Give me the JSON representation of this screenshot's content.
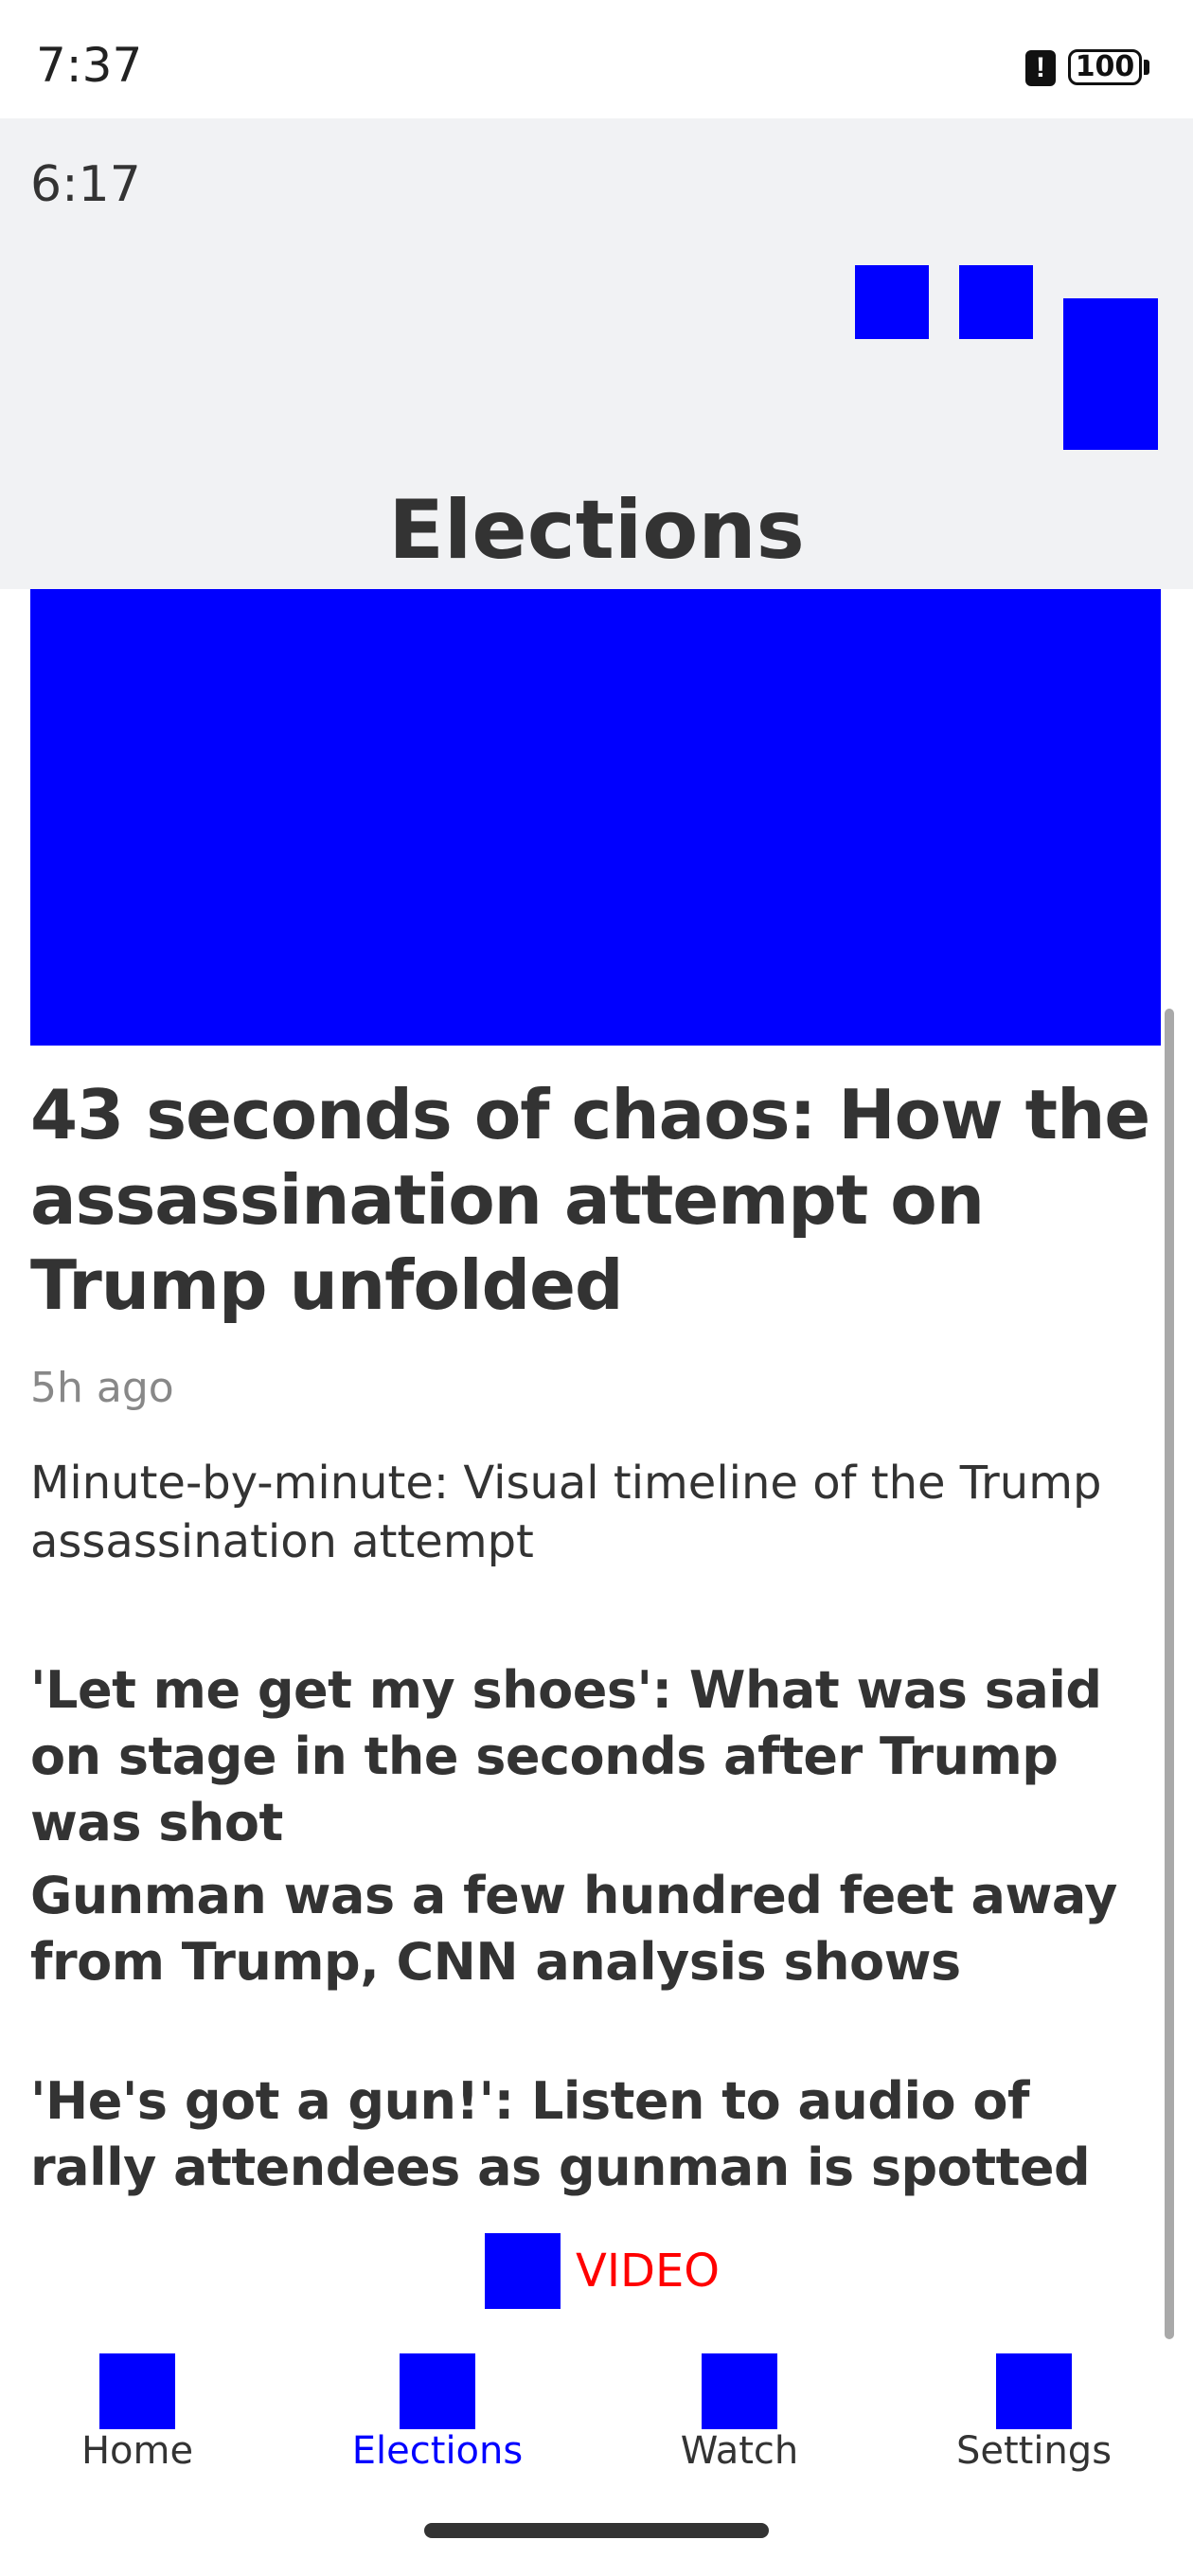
{
  "status_bar": {
    "time": "7:37",
    "alert_icon": "alert-icon",
    "alert_glyph": "!",
    "battery_icon": "battery-icon",
    "battery_level": "100"
  },
  "header": {
    "time": "6:17",
    "title": "Elections",
    "action_icons": [
      "image-placeholder-icon",
      "image-placeholder-icon",
      "image-placeholder-icon"
    ]
  },
  "featured_story": {
    "image": "hero-image-placeholder",
    "headline": "43 seconds of chaos: How the assassination attempt on Trump unfolded",
    "time_ago": "5h ago",
    "subline": "Minute-by-minute: Visual timeline of the Trump assassination attempt"
  },
  "related_stories": [
    {
      "title": "'Let me get my shoes': What was said on stage in the seconds after Trump was shot"
    },
    {
      "title": "Gunman was a few hundred feet away from Trump, CNN analysis shows"
    },
    {
      "title": "'He's got a gun!': Listen to audio of rally attendees as gunman is spotted"
    }
  ],
  "video_link": {
    "icon": "video-icon",
    "label": "VIDEO"
  },
  "bottom_nav": {
    "items": [
      {
        "label": "Home",
        "icon": "home-icon"
      },
      {
        "label": "Elections",
        "icon": "elections-icon",
        "active": true
      },
      {
        "label": "Watch",
        "icon": "watch-icon"
      },
      {
        "label": "Settings",
        "icon": "settings-icon"
      }
    ]
  },
  "colors": {
    "placeholder_blue": "#0000ff",
    "active_nav": "#0000ff",
    "video_label": "#ff0000",
    "header_bg": "#f1f2f4",
    "text": "#333333",
    "muted_text": "#888888"
  }
}
